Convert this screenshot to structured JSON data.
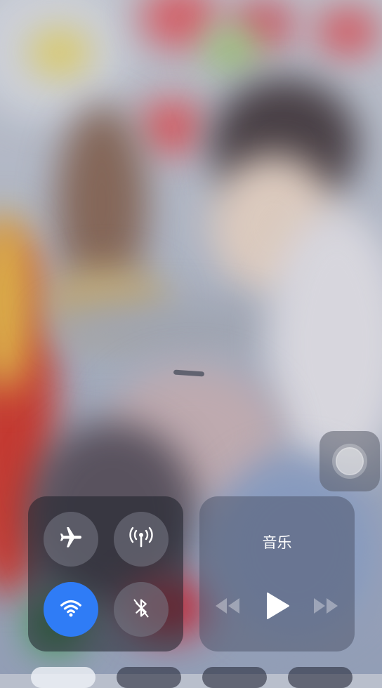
{
  "control_center": {
    "connectivity": {
      "airplane_mode": "off",
      "cellular_data": "off",
      "wifi": "on",
      "bluetooth": "off"
    },
    "music": {
      "title": "音乐",
      "icons": {
        "previous": "rewind-icon",
        "play": "play-icon",
        "next": "fast-forward-icon"
      }
    }
  },
  "colors": {
    "toggle_on": "#2f7cf6",
    "toggle_off": "#787a87"
  }
}
